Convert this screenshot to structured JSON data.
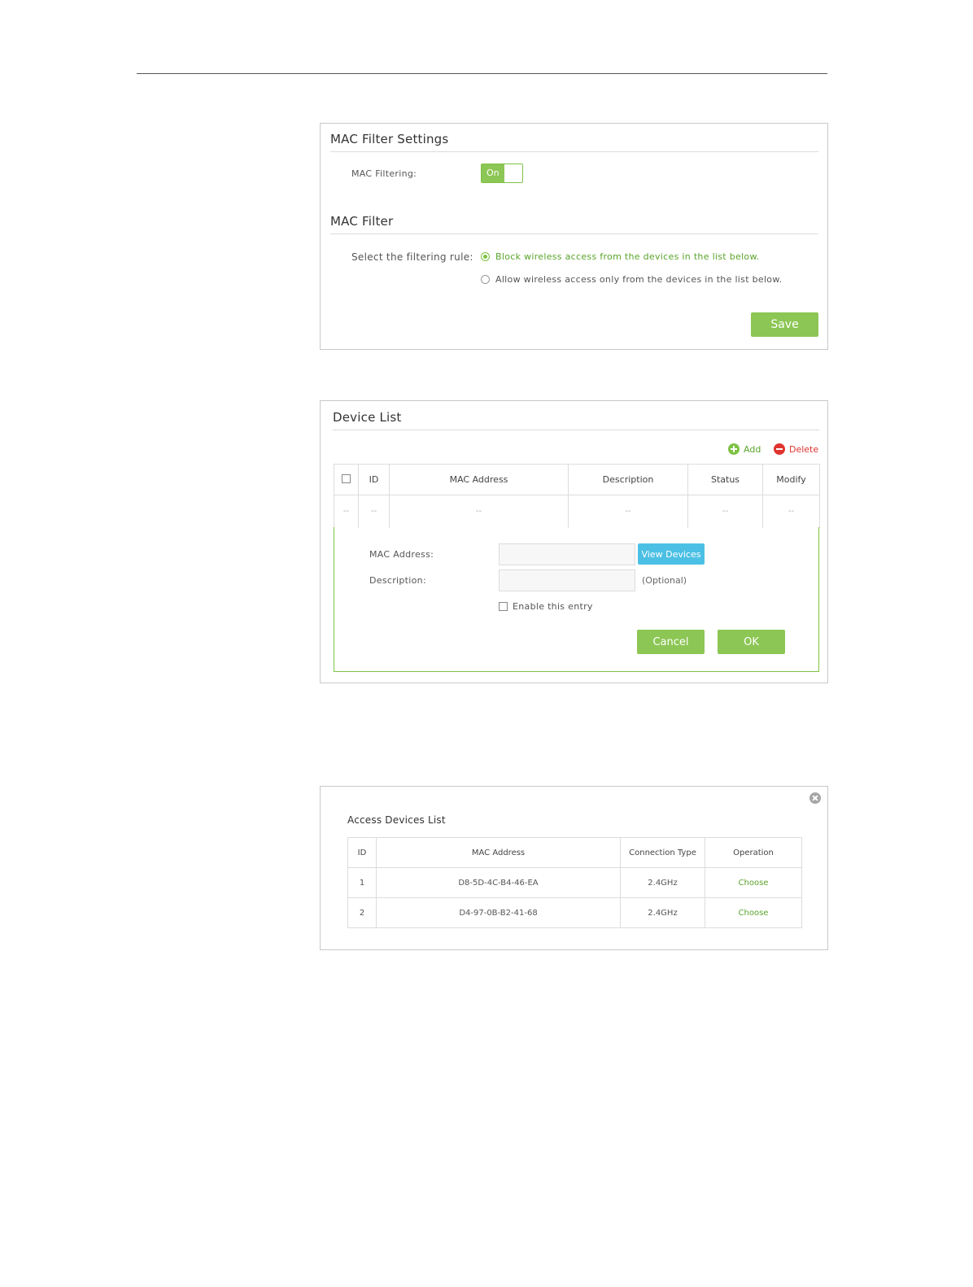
{
  "mac_filter_settings": {
    "title": "MAC Filter Settings",
    "mac_filtering_label": "MAC Filtering:",
    "toggle_label": "On"
  },
  "mac_filter": {
    "title": "MAC Filter",
    "rule_label": "Select the filtering rule:",
    "option_block": "Block wireless access from the devices in the list below.",
    "option_allow": "Allow wireless access only from the devices in the list below.",
    "selected": "block",
    "save_label": "Save"
  },
  "device_list": {
    "title": "Device List",
    "add_label": "Add",
    "delete_label": "Delete",
    "columns": [
      "ID",
      "MAC Address",
      "Description",
      "Status",
      "Modify"
    ],
    "empty_row": [
      "--",
      "--",
      "--",
      "--",
      "--",
      "--"
    ],
    "form": {
      "mac_label": "MAC Address:",
      "mac_value": "",
      "view_devices_label": "View Devices",
      "description_label": "Description:",
      "description_value": "",
      "optional_note": "(Optional)",
      "enable_label": "Enable this entry",
      "cancel_label": "Cancel",
      "ok_label": "OK"
    }
  },
  "access_devices": {
    "title": "Access Devices List",
    "columns": [
      "ID",
      "MAC Address",
      "Connection Type",
      "Operation"
    ],
    "rows": [
      {
        "id": "1",
        "mac": "D8-5D-4C-B4-46-EA",
        "type": "2.4GHz",
        "operation": "Choose"
      },
      {
        "id": "2",
        "mac": "D4-97-0B-B2-41-68",
        "type": "2.4GHz",
        "operation": "Choose"
      }
    ]
  },
  "colors": {
    "accent_green": "#8cc654",
    "text_green": "#5aa42b",
    "accent_blue": "#4cc0e4",
    "delete_red": "#e0332f"
  }
}
